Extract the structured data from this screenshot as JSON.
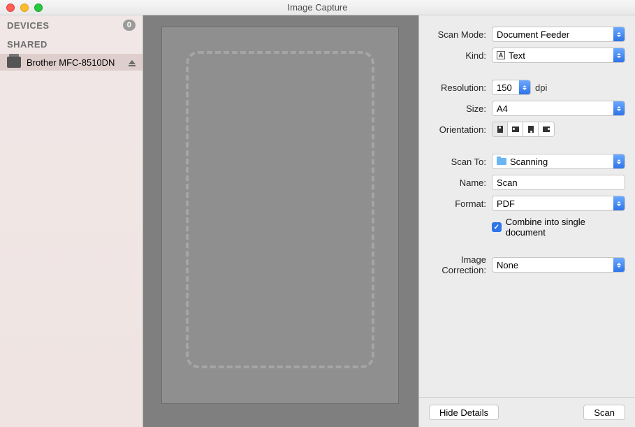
{
  "window": {
    "title": "Image Capture"
  },
  "sidebar": {
    "devices_header": "DEVICES",
    "devices_count": "0",
    "shared_header": "SHARED",
    "device_name": "Brother MFC-8510DN"
  },
  "form": {
    "scan_mode": {
      "label": "Scan Mode:",
      "value": "Document Feeder"
    },
    "kind": {
      "label": "Kind:",
      "value": "Text"
    },
    "resolution": {
      "label": "Resolution:",
      "value": "150",
      "unit": "dpi"
    },
    "size": {
      "label": "Size:",
      "value": "A4"
    },
    "orientation": {
      "label": "Orientation:"
    },
    "scan_to": {
      "label": "Scan To:",
      "value": "Scanning"
    },
    "name": {
      "label": "Name:",
      "value": "Scan"
    },
    "format": {
      "label": "Format:",
      "value": "PDF"
    },
    "combine": {
      "label": "Combine into single document"
    },
    "image_correction": {
      "label": "Image Correction:",
      "value": "None"
    }
  },
  "actions": {
    "hide_details": "Hide Details",
    "scan": "Scan"
  }
}
